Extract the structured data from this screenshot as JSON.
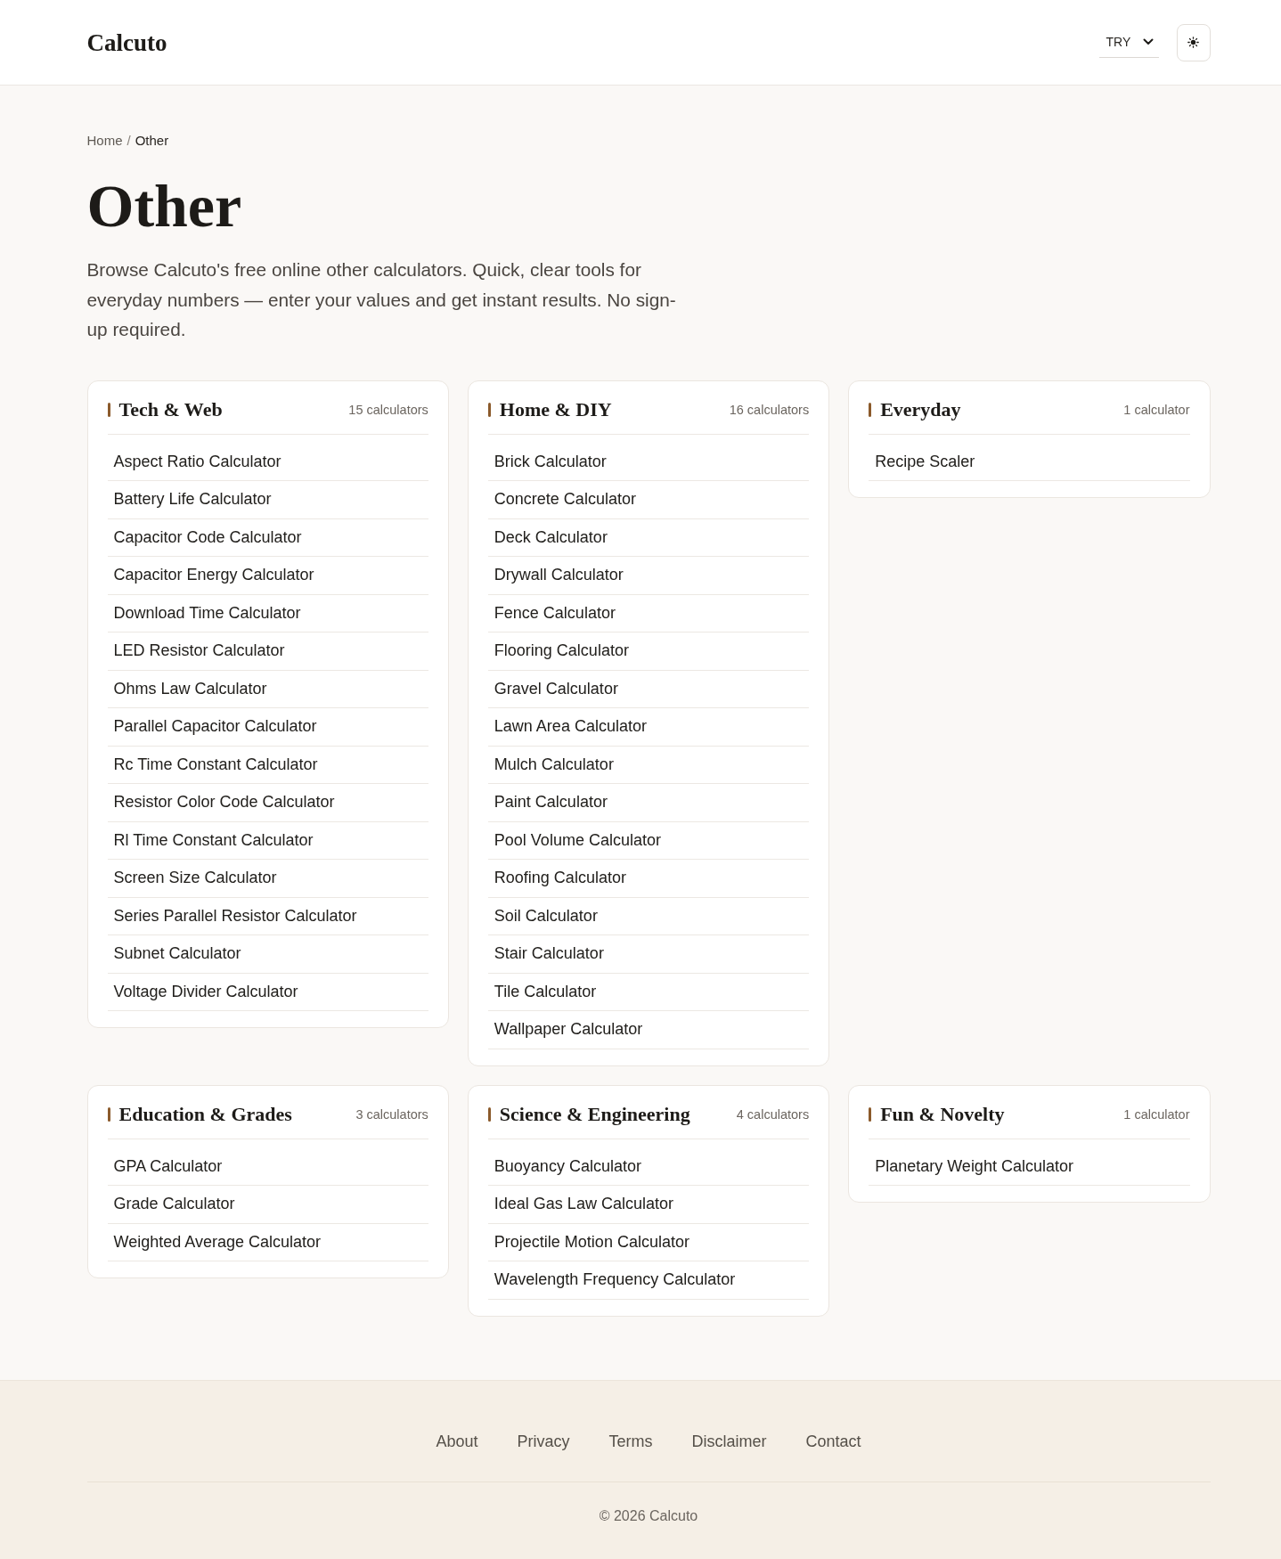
{
  "header": {
    "logo": "Calcuto",
    "currency": {
      "value": "TRY"
    }
  },
  "breadcrumb": {
    "items": [
      {
        "label": "Home",
        "current": false
      },
      {
        "label": "Other",
        "current": true
      }
    ],
    "separator": "/"
  },
  "page": {
    "title": "Other",
    "intro": "Browse Calcuto's free online other calculators. Quick, clear tools for everyday numbers — enter your values and get instant results. No sign-up required."
  },
  "categories": [
    {
      "title": "Tech & Web",
      "count": "15 calculators",
      "links": [
        "Aspect Ratio Calculator",
        "Battery Life Calculator",
        "Capacitor Code Calculator",
        "Capacitor Energy Calculator",
        "Download Time Calculator",
        "LED Resistor Calculator",
        "Ohms Law Calculator",
        "Parallel Capacitor Calculator",
        "Rc Time Constant Calculator",
        "Resistor Color Code Calculator",
        "Rl Time Constant Calculator",
        "Screen Size Calculator",
        "Series Parallel Resistor Calculator",
        "Subnet Calculator",
        "Voltage Divider Calculator"
      ]
    },
    {
      "title": "Home & DIY",
      "count": "16 calculators",
      "links": [
        "Brick Calculator",
        "Concrete Calculator",
        "Deck Calculator",
        "Drywall Calculator",
        "Fence Calculator",
        "Flooring Calculator",
        "Gravel Calculator",
        "Lawn Area Calculator",
        "Mulch Calculator",
        "Paint Calculator",
        "Pool Volume Calculator",
        "Roofing Calculator",
        "Soil Calculator",
        "Stair Calculator",
        "Tile Calculator",
        "Wallpaper Calculator"
      ]
    },
    {
      "title": "Everyday",
      "count": "1 calculator",
      "links": [
        "Recipe Scaler"
      ]
    },
    {
      "title": "Education & Grades",
      "count": "3 calculators",
      "links": [
        "GPA Calculator",
        "Grade Calculator",
        "Weighted Average Calculator"
      ]
    },
    {
      "title": "Science & Engineering",
      "count": "4 calculators",
      "links": [
        "Buoyancy Calculator",
        "Ideal Gas Law Calculator",
        "Projectile Motion Calculator",
        "Wavelength Frequency Calculator"
      ]
    },
    {
      "title": "Fun & Novelty",
      "count": "1 calculator",
      "links": [
        "Planetary Weight Calculator"
      ]
    }
  ],
  "footer": {
    "links": [
      "About",
      "Privacy",
      "Terms",
      "Disclaimer",
      "Contact"
    ],
    "copyright": "© 2026 Calcuto"
  }
}
